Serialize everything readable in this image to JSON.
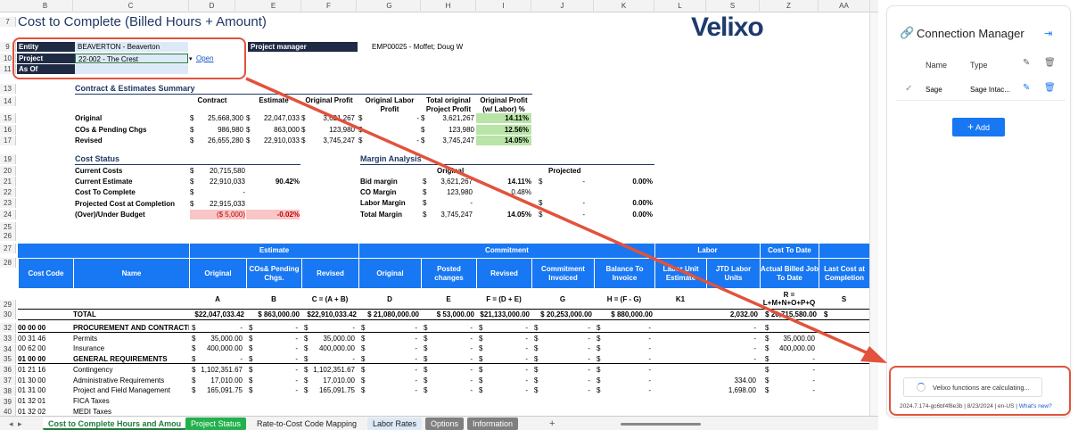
{
  "sheet": {
    "columns": [
      "B",
      "C",
      "D",
      "E",
      "F",
      "G",
      "H",
      "I",
      "J",
      "K",
      "L",
      "S",
      "Z",
      "AA"
    ],
    "title": "Cost to Complete (Billed Hours + Amount)",
    "logo": "Velixo",
    "row_numbers": [
      "7",
      "9",
      "10",
      "11",
      "13",
      "14",
      "15",
      "16",
      "17",
      "19",
      "20",
      "21",
      "22",
      "23",
      "24",
      "25",
      "26",
      "27",
      "28",
      "29",
      "30",
      "32",
      "33",
      "34",
      "35",
      "36",
      "37",
      "38",
      "39",
      "40"
    ],
    "header": {
      "entity_label": "Entity",
      "entity_value": "BEAVERTON - Beaverton",
      "project_label": "Project",
      "project_value": "22-002 - The Crest",
      "open_link": "Open",
      "asof_label": "As Of",
      "asof_value": "",
      "pm_label": "Project manager",
      "pm_value": "EMP00025 - Moffet; Doug W"
    },
    "summary": {
      "title": "Contract & Estimates Summary",
      "cols": [
        "Contract",
        "Estimate",
        "Original Profit",
        "Original Labor Profit",
        "Total original Project Profit",
        "Original Profit (w/ Labor) %"
      ],
      "rows": [
        {
          "label": "Original",
          "contract": "25,668,300",
          "estimate": "22,047,033",
          "profit": "3,621,267",
          "labor": "-",
          "total": "3,621,267",
          "pct": "14.11%"
        },
        {
          "label": "COs & Pending Chgs",
          "contract": "986,980",
          "estimate": "863,000",
          "profit": "123,980",
          "labor": "",
          "total": "123,980",
          "pct": "12.56%"
        },
        {
          "label": "Revised",
          "contract": "26,655,280",
          "estimate": "22,910,033",
          "profit": "3,745,247",
          "labor": "-",
          "total": "3,745,247",
          "pct": "14.05%"
        }
      ]
    },
    "cost_status": {
      "title": "Cost Status",
      "rows": [
        {
          "label": "Current Costs",
          "value": "20,715,580",
          "pct": ""
        },
        {
          "label": "Current Estimate",
          "value": "22,910,033",
          "pct": "90.42%"
        },
        {
          "label": "Cost To Complete",
          "value": "-",
          "pct": ""
        },
        {
          "label": "Projected Cost at Completion",
          "value": "22,915,033",
          "pct": ""
        },
        {
          "label": "(Over)/Under Budget",
          "value": "($ 5,000)",
          "pct": "-0.02%"
        }
      ]
    },
    "margin": {
      "title": "Margin Analysis",
      "col_original": "Original",
      "col_projected": "Projected",
      "rows": [
        {
          "label": "Bid margin",
          "orig": "3,621,267",
          "opct": "14.11%",
          "proj": "-",
          "ppct": "0.00%"
        },
        {
          "label": "CO Margin",
          "orig": "123,980",
          "opct": "0.48%",
          "proj": "",
          "ppct": ""
        },
        {
          "label": "Labor Margin",
          "orig": "-",
          "opct": "",
          "proj": "-",
          "ppct": "0.00%"
        },
        {
          "label": "Total Margin",
          "orig": "3,745,247",
          "opct": "14.05%",
          "proj": "-",
          "ppct": "0.00%"
        }
      ]
    },
    "grid": {
      "groups": [
        "Estimate",
        "Commitment",
        "Labor",
        "Cost To Date"
      ],
      "cols": [
        "Cost Code",
        "Name",
        "Original",
        "COs& Pending Chgs.",
        "Revised",
        "Original",
        "Posted changes",
        "Revised",
        "Commitment Invoiced",
        "Balance To Invoice",
        "Labor Unit Estimate",
        "JTD Labor Units",
        "Actual Billed Job To Date",
        "Last Cost at Completion"
      ],
      "formulas": [
        "",
        "",
        "A",
        "B",
        "C = (A + B)",
        "D",
        "E",
        "F = (D + E)",
        "G",
        "H = (F - G)",
        "K1",
        "",
        "R = L+M+N+O+P+Q",
        "S"
      ],
      "total": {
        "label": "TOTAL",
        "a": "$22,047,033.42",
        "b": "$ 863,000.00",
        "c": "$22,910,033.42",
        "d": "$ 21,080,000.00",
        "e": "$ 53,000.00",
        "f": "$21,133,000.00",
        "g": "$ 20,253,000.00",
        "h": "$ 880,000.00",
        "jtd": "2,032.00",
        "actual": "$ 20,715,580.00"
      },
      "rows": [
        {
          "code": "00 00 00",
          "name": "PROCUREMENT AND CONTRACTI",
          "bold": true,
          "a": "-",
          "b": "-",
          "c": "-",
          "d": "-",
          "e": "-",
          "f": "-",
          "g": "-",
          "h": "-",
          "jtd": "-",
          "actual": "-"
        },
        {
          "code": "00 31 46",
          "name": "Permits",
          "bold": false,
          "a": "35,000.00",
          "b": "-",
          "c": "35,000.00",
          "d": "-",
          "e": "-",
          "f": "-",
          "g": "-",
          "h": "-",
          "jtd": "-",
          "actual": "35,000.00"
        },
        {
          "code": "00 62 00",
          "name": "Insurance",
          "bold": false,
          "a": "400,000.00",
          "b": "-",
          "c": "400,000.00",
          "d": "-",
          "e": "-",
          "f": "-",
          "g": "-",
          "h": "-",
          "jtd": "-",
          "actual": "400,000.00"
        },
        {
          "code": "01 00 00",
          "name": "GENERAL REQUIREMENTS",
          "bold": true,
          "a": "-",
          "b": "-",
          "c": "-",
          "d": "-",
          "e": "-",
          "f": "-",
          "g": "-",
          "h": "-",
          "jtd": "-",
          "actual": "-"
        },
        {
          "code": "01 21 16",
          "name": "Contingency",
          "bold": false,
          "a": "1,102,351.67",
          "b": "-",
          "c": "1,102,351.67",
          "d": "-",
          "e": "-",
          "f": "-",
          "g": "-",
          "h": "-",
          "jtd": "",
          "actual": "-"
        },
        {
          "code": "01 30 00",
          "name": "Administrative Requirements",
          "bold": false,
          "a": "17,010.00",
          "b": "-",
          "c": "17,010.00",
          "d": "-",
          "e": "-",
          "f": "-",
          "g": "-",
          "h": "-",
          "jtd": "334.00",
          "actual": "-"
        },
        {
          "code": "01 31 00",
          "name": "Project and Field Management",
          "bold": false,
          "a": "165,091.75",
          "b": "-",
          "c": "165,091.75",
          "d": "-",
          "e": "-",
          "f": "-",
          "g": "-",
          "h": "-",
          "jtd": "1,698.00",
          "actual": "-"
        },
        {
          "code": "01 32 01",
          "name": "FICA Taxes",
          "bold": false,
          "a": "",
          "b": "",
          "c": "",
          "d": "",
          "e": "",
          "f": "",
          "g": "",
          "h": "",
          "jtd": "",
          "actual": ""
        },
        {
          "code": "01 32 02",
          "name": "MEDI Taxes",
          "bold": false,
          "a": "",
          "b": "",
          "c": "",
          "d": "",
          "e": "",
          "f": "",
          "g": "",
          "h": "",
          "jtd": "",
          "actual": ""
        }
      ]
    }
  },
  "tabs": [
    {
      "label": "Cost to Complete Hours and Amou",
      "style": "active"
    },
    {
      "label": "Project Status",
      "style": "green"
    },
    {
      "label": "Rate-to-Cost Code Mapping",
      "style": "plain"
    },
    {
      "label": "Labor Rates",
      "style": "lightblue"
    },
    {
      "label": "Options",
      "style": "gray"
    },
    {
      "label": "Information",
      "style": "gray"
    }
  ],
  "add_sheet_glyph": "+",
  "panel": {
    "title": "Connection Manager",
    "col_name": "Name",
    "col_type": "Type",
    "conn_name": "Sage",
    "conn_type": "Sage Intac...",
    "add_label": "Add",
    "status": "Velixo functions are calculating...",
    "version": "2024.7.174-gc6bf4f8e3b | 8/23/2024 | en-US |",
    "whats_new": "What's new?"
  },
  "colors": {
    "accent": "#1877f2",
    "navy": "#1f2a44",
    "highlight": "#e2523c"
  }
}
